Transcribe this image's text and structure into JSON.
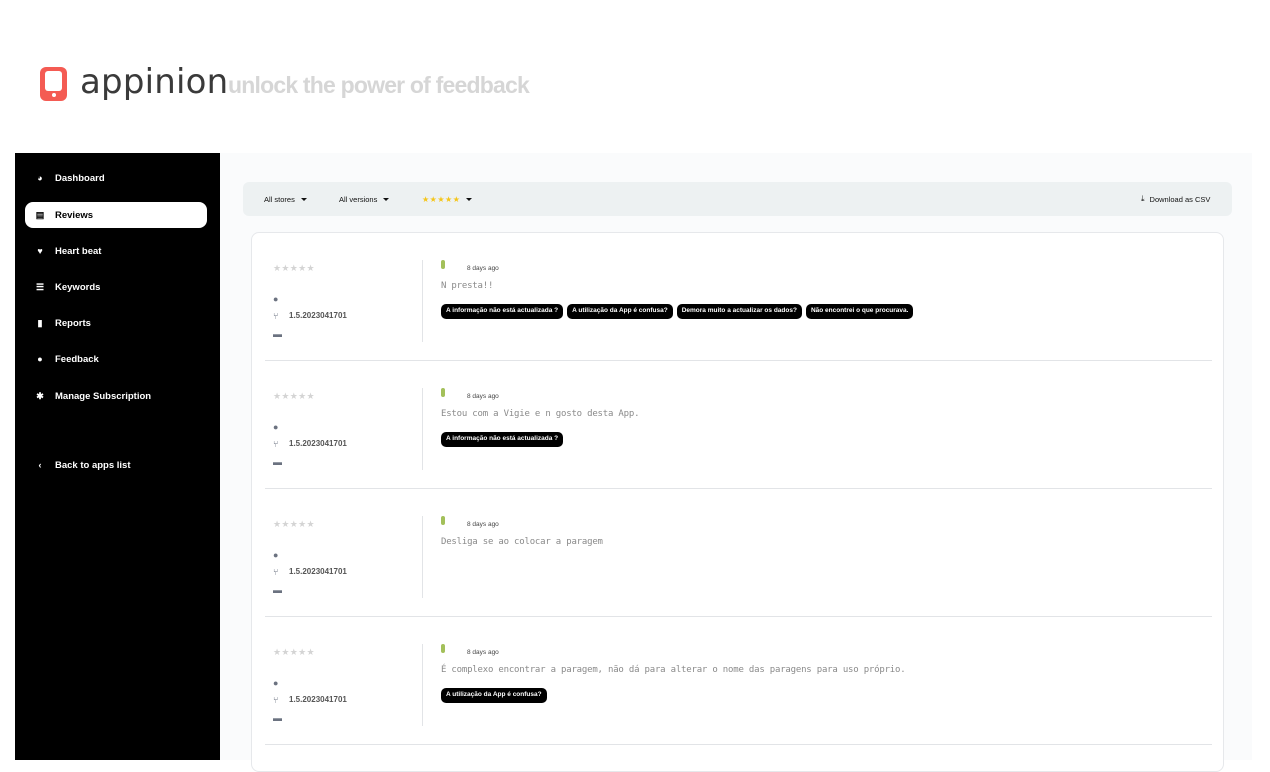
{
  "header": {
    "brand": "appinion",
    "tagline": "unlock the power of feedback"
  },
  "sidebar": {
    "items": [
      {
        "label": "Dashboard",
        "icon": "dashboard-icon",
        "glyph": "◕",
        "active": false
      },
      {
        "label": "Reviews",
        "icon": "list-icon",
        "glyph": "▤",
        "active": true
      },
      {
        "label": "Heart beat",
        "icon": "heartbeat-icon",
        "glyph": "♥",
        "active": false
      },
      {
        "label": "Keywords",
        "icon": "bullet-list-icon",
        "glyph": "☰",
        "active": false
      },
      {
        "label": "Reports",
        "icon": "report-icon",
        "glyph": "▮",
        "active": false
      },
      {
        "label": "Feedback",
        "icon": "chat-bubble-icon",
        "glyph": "●",
        "active": false
      },
      {
        "label": "Manage Subscription",
        "icon": "gear-icon",
        "glyph": "✱",
        "active": false
      }
    ],
    "back_label": "Back to apps list"
  },
  "toolbar": {
    "stores": "All stores",
    "versions": "All versions",
    "rating": "★★★★★",
    "download": "Download as CSV"
  },
  "reviews": [
    {
      "stars": "★★★★★",
      "version": "1.5.2023041701",
      "date": "8 days ago",
      "text": "N presta!!",
      "tags": [
        "A informação não está actualizada ?",
        "A utilização da App é confusa?",
        "Demora muito a actualizar os dados?",
        "Não encontrei o que procurava."
      ]
    },
    {
      "stars": "★★★★★",
      "version": "1.5.2023041701",
      "date": "8 days ago",
      "text": "Estou com a Vigie e n gosto desta App.",
      "tags": [
        "A informação não está actualizada ?"
      ]
    },
    {
      "stars": "★★★★★",
      "version": "1.5.2023041701",
      "date": "8 days ago",
      "text": "Desliga se ao colocar a paragem",
      "tags": []
    },
    {
      "stars": "★★★★★",
      "version": "1.5.2023041701",
      "date": "8 days ago",
      "text": "É complexo encontrar a paragem, não dá para alterar o nome das paragens para uso próprio.",
      "tags": [
        "A utilização da App é confusa?"
      ]
    }
  ]
}
